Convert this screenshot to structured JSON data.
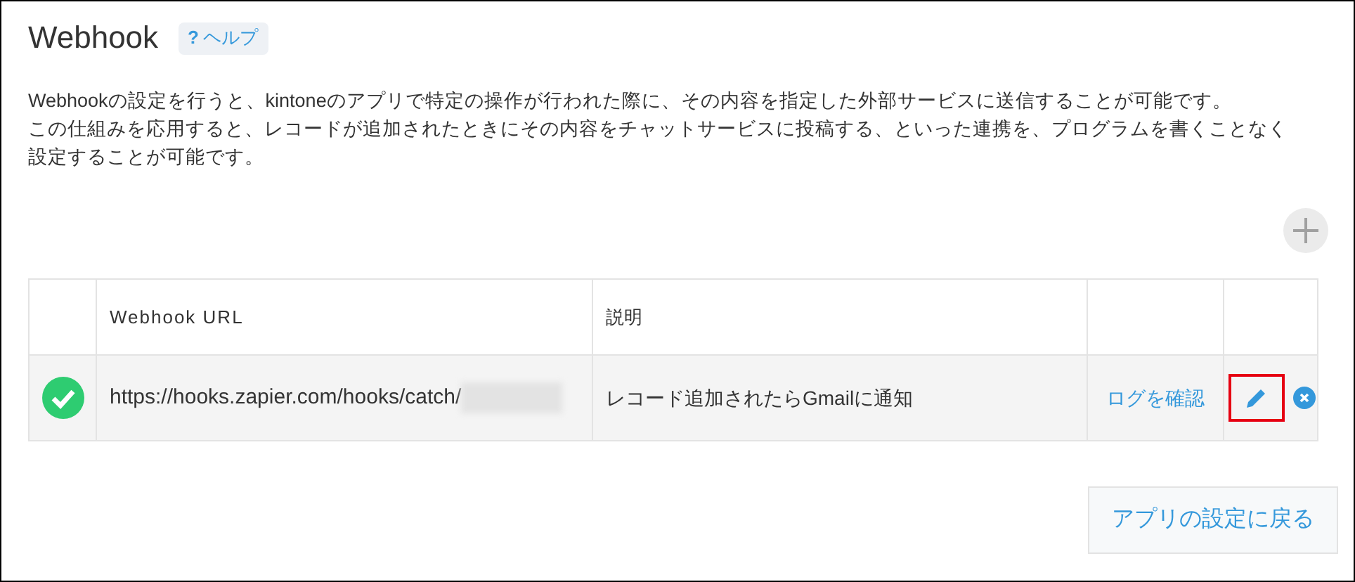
{
  "title": "Webhook",
  "help_link": {
    "icon": "?",
    "label": "ヘルプ"
  },
  "description": [
    "Webhookの設定を行うと、kintoneのアプリで特定の操作が行われた際に、その内容を指定した外部サービスに送信することが可能です。",
    "この仕組みを応用すると、レコードが追加されたときにその内容をチャットサービスに投稿する、といった連携を、プログラムを書くことなく設定することが可能です。"
  ],
  "table": {
    "columns": [
      "Webhook URL",
      "説明"
    ],
    "rows": [
      {
        "enabled": true,
        "url": "https://hooks.zapier.com/hooks/catch/",
        "url_redacted": true,
        "description": "レコード追加されたらGmailに通知",
        "log_link": "ログを確認",
        "edit_highlighted": true
      }
    ]
  },
  "back_button": "アプリの設定に戻る"
}
